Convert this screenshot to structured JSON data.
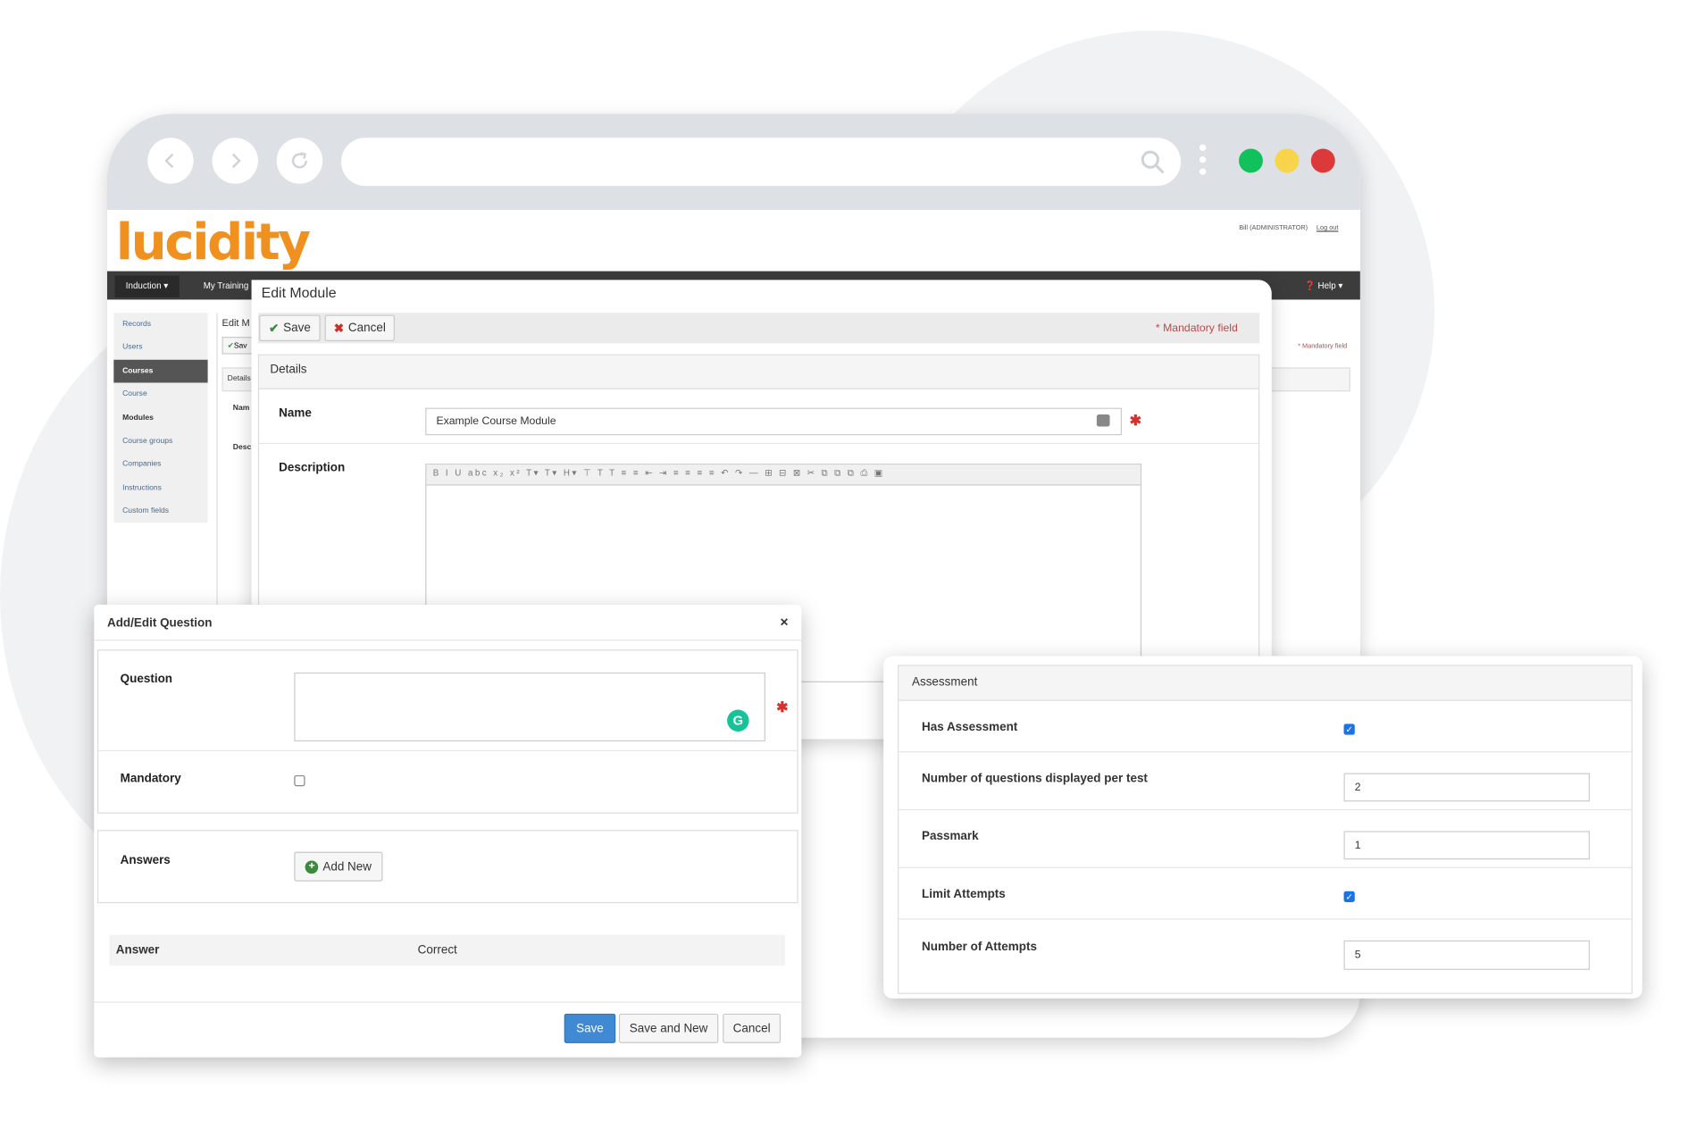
{
  "app": {
    "logo": "lucidity",
    "user": "Bill (ADMINISTRATOR)",
    "logout": "Log out"
  },
  "nav": {
    "induction": "Induction ▾",
    "training": "My Training",
    "help": "Help ▾"
  },
  "sidebar": {
    "items": [
      "Records",
      "Users",
      "Courses",
      "Course",
      "Modules",
      "Course groups",
      "Companies",
      "Instructions",
      "Custom fields"
    ]
  },
  "background": {
    "edit_label": "Edit M",
    "save_label": "Sav",
    "details_label": "Details",
    "name_label": "Nam",
    "desc_label": "Desc",
    "mandatory": "* Mandatory field"
  },
  "edit_module": {
    "title": "Edit Module",
    "save": "Save",
    "cancel": "Cancel",
    "mandatory": "* Mandatory field",
    "details": "Details",
    "name_label": "Name",
    "name_value": "Example Course Module",
    "description_label": "Description",
    "toolbar": "B I U abc x₂ x² T▾ T▾ H▾ ⊤ T T ≡ ≡ ⇤ ⇥ ≡ ≡ ≡ ≡ ↶ ↷ — ⊞ ⊟ ⊠ ✂ ⧉ ⧉ ⧉ ⎙ ▣"
  },
  "add_question": {
    "title": "Add/Edit Question",
    "close": "×",
    "question_label": "Question",
    "question_value": "",
    "mandatory_label": "Mandatory",
    "mandatory_checked": false,
    "answers_label": "Answers",
    "add_new": "Add New",
    "col_answer": "Answer",
    "col_correct": "Correct",
    "save": "Save",
    "save_new": "Save and New",
    "cancel": "Cancel"
  },
  "assessment": {
    "title": "Assessment",
    "has_assessment_label": "Has Assessment",
    "has_assessment": true,
    "questions_label": "Number of questions displayed per test",
    "questions_value": "2",
    "passmark_label": "Passmark",
    "passmark_value": "1",
    "limit_label": "Limit Attempts",
    "limit_attempts": true,
    "attempts_label": "Number of Attempts",
    "attempts_value": "5"
  },
  "colors": {
    "brand": "#f0901f",
    "primary": "#3276b1",
    "danger": "#d2322d",
    "success": "#3c8b3c",
    "navbar": "#3c3c3c"
  }
}
